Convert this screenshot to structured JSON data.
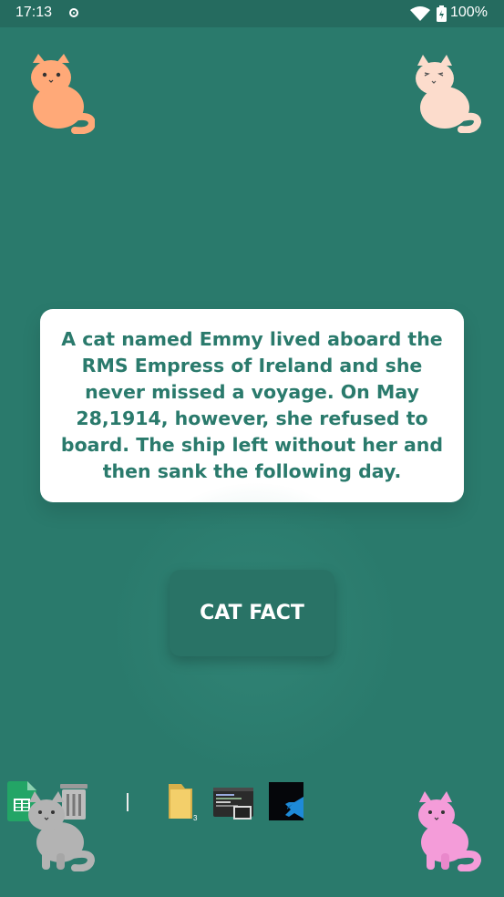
{
  "status_bar": {
    "time": "17:13",
    "battery": "100%"
  },
  "fact": {
    "text": "A cat named Emmy lived aboard the RMS Empress of Ireland and she never missed a voyage. On May 28,1914, however, she refused to board. The ship left without her and then sank the following day."
  },
  "button": {
    "label": "CAT FACT"
  },
  "dock": {
    "folder_badge": "3"
  },
  "colors": {
    "background": "#2a7a6c",
    "card": "#ffffff",
    "text": "#2a7a6c",
    "button": "#297366"
  }
}
